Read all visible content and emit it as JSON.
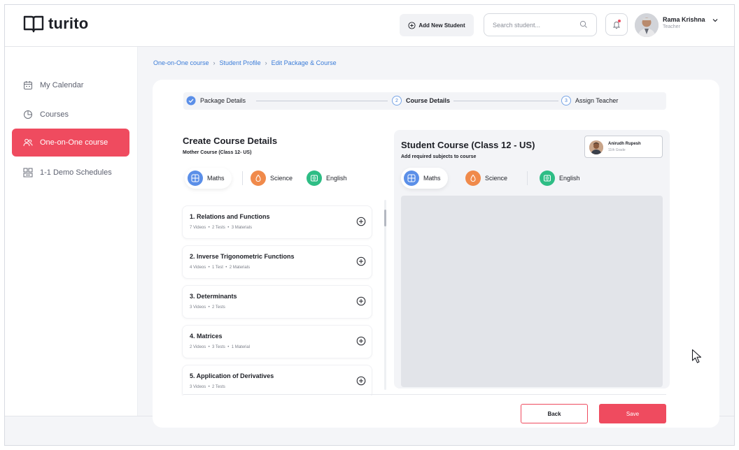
{
  "app": {
    "logo_text": "turito"
  },
  "header": {
    "add_student_label": "Add New Student",
    "search_placeholder": "Search student...",
    "user_name": "Rama Krishna",
    "user_role": "Teacher"
  },
  "sidebar": {
    "items": [
      {
        "label": "My Calendar",
        "icon": "calendar-icon",
        "active": false
      },
      {
        "label": "Courses",
        "icon": "pie-chart-icon",
        "active": false
      },
      {
        "label": "One-on-One course",
        "icon": "users-icon",
        "active": true
      },
      {
        "label": "1-1 Demo Schedules",
        "icon": "schedule-icon",
        "active": false
      }
    ]
  },
  "breadcrumb": [
    "One-on-One course",
    "Student Profile",
    "Edit Package & Course"
  ],
  "stepper": {
    "steps": [
      {
        "label": "Package Details",
        "state": "done"
      },
      {
        "label": "Course Details",
        "number": "2",
        "state": "current"
      },
      {
        "label": "Assign Teacher",
        "number": "3",
        "state": "upcoming"
      }
    ]
  },
  "left": {
    "title": "Create Course Details",
    "subtitle": "Mother Course (Class 12- US)",
    "subjects": [
      "Maths",
      "Science",
      "English"
    ],
    "topics": [
      {
        "title": "1. Relations and Functions",
        "meta": [
          "7 Videos",
          "2 Tests",
          "3 Materials"
        ]
      },
      {
        "title": "2. Inverse Trigonometric Functions",
        "meta": [
          "4 Videos",
          "1 Test",
          "2 Materials"
        ]
      },
      {
        "title": "3. Determinants",
        "meta": [
          "3 Videos",
          "2 Tests"
        ]
      },
      {
        "title": "4. Matrices",
        "meta": [
          "2 Videos",
          "3 Tests",
          "1 Material"
        ]
      },
      {
        "title": "5. Application of Derivatives",
        "meta": [
          "3 Videos",
          "2 Tests"
        ]
      }
    ]
  },
  "right": {
    "title": "Student Course (Class 12 - US)",
    "subtitle": "Add required subjects to course",
    "student_name": "Anirudh Rupesh",
    "student_grade": "11th Grade",
    "subjects": [
      "Maths",
      "Science",
      "English"
    ]
  },
  "actions": {
    "back_label": "Back",
    "save_label": "Save"
  },
  "colors": {
    "accent": "#EF4B5F",
    "link": "#3B7CD8",
    "maths": "#5B8FE8",
    "science": "#F08A4B",
    "english": "#2EBD85"
  }
}
